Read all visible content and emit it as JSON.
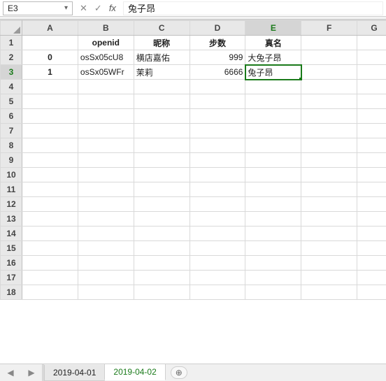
{
  "name_box": "E3",
  "fb": {
    "cancel": "✕",
    "confirm": "✓",
    "fx": "fx"
  },
  "formula_value": "兔子昂",
  "columns": [
    "A",
    "B",
    "C",
    "D",
    "E",
    "F",
    "G"
  ],
  "row_numbers": [
    1,
    2,
    3,
    4,
    5,
    6,
    7,
    8,
    9,
    10,
    11,
    12,
    13,
    14,
    15,
    16,
    17,
    18
  ],
  "headers": {
    "B": "openid",
    "C": "昵称",
    "D": "步数",
    "E": "真名"
  },
  "rows": [
    {
      "A": "0",
      "B": "osSx05cU8",
      "C": "横店嘉佑",
      "D": 999,
      "E": "大兔子昂"
    },
    {
      "A": "1",
      "B": "osSx05WFr",
      "C": "茉莉",
      "D": 6666,
      "E": "兔子昂"
    }
  ],
  "selected": {
    "col": "E",
    "row": 3
  },
  "tabs": [
    "2019-04-01",
    "2019-04-02"
  ],
  "active_tab": 1,
  "add_icon": "⊕",
  "nav_icons": {
    "left": "◀",
    "right": "▶"
  }
}
